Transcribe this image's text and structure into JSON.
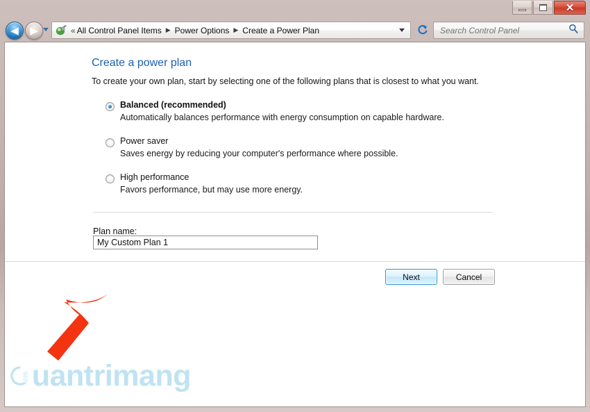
{
  "window": {
    "controls": {
      "minimize": "Minimize",
      "maximize": "Maximize",
      "close": "✕"
    }
  },
  "navigation": {
    "back_label": "Back",
    "forward_label": "Forward",
    "back_glyph": "◀",
    "forward_glyph": "▶",
    "history_dropdown_label": "Recent pages",
    "breadcrumb_prefix": "«",
    "breadcrumbs": [
      {
        "label": "All Control Panel Items"
      },
      {
        "label": "Power Options"
      },
      {
        "label": "Create a Power Plan"
      }
    ],
    "breadcrumb_separator": "▶",
    "address_dropdown_label": "Previous locations",
    "refresh_label": "Refresh"
  },
  "search": {
    "placeholder": "Search Control Panel",
    "value": "",
    "icon": "search-icon"
  },
  "page": {
    "title": "Create a power plan",
    "subtitle": "To create your own plan, start by selecting one of the following plans that is closest to what you want."
  },
  "plans": [
    {
      "label": "Balanced (recommended)",
      "description": "Automatically balances performance with energy consumption on capable hardware.",
      "selected": true
    },
    {
      "label": "Power saver",
      "description": "Saves energy by reducing your computer's performance where possible.",
      "selected": false
    },
    {
      "label": "High performance",
      "description": "Favors performance, but may use more energy.",
      "selected": false
    }
  ],
  "plan_name": {
    "label": "Plan name:",
    "value": "My Custom Plan 1",
    "placeholder": ""
  },
  "buttons": {
    "next": "Next",
    "cancel": "Cancel"
  },
  "watermark": {
    "text": "uantrimang",
    "full_text": "Quantrimang",
    "color": "#bfe3f2"
  },
  "annotation": {
    "arrow_color": "#f43411",
    "points_to": "plan-name-input"
  },
  "colors": {
    "accent_blue": "#1c5fb0",
    "close_red": "#c63a25",
    "default_button_border": "#2c93d0"
  }
}
